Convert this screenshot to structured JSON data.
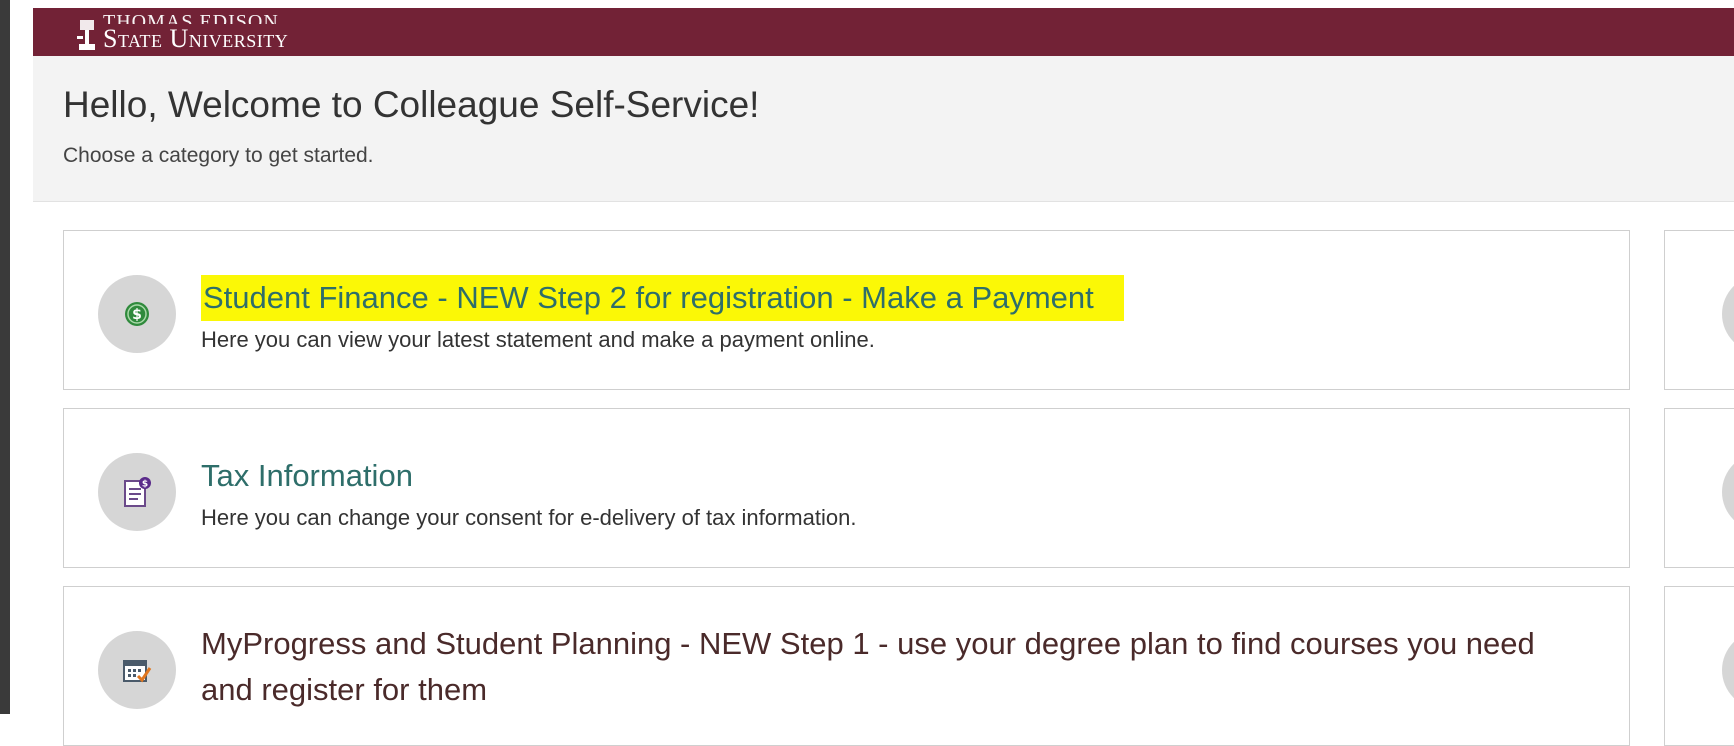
{
  "header": {
    "logo_line1": "THOMAS EDISON",
    "logo_line2": "State University"
  },
  "welcome": {
    "title": "Hello, Welcome to Colleague Self-Service!",
    "subtitle": "Choose a category to get started."
  },
  "categories": [
    {
      "title": "Student Finance - NEW Step 2 for registration - Make a Payment",
      "description": "Here you can view your latest statement and make a payment online.",
      "icon": "dollar-coin-icon",
      "highlighted": true
    },
    {
      "title": "Tax Information",
      "description": "Here you can change your consent for e-delivery of tax information.",
      "icon": "tax-document-icon"
    },
    {
      "title": "MyProgress and Student Planning - NEW Step 1 - use your degree plan to find courses you need and register for them",
      "description": "",
      "icon": "calendar-check-icon"
    }
  ],
  "colors": {
    "header_bg": "#722236",
    "title_teal": "#2e6e6a",
    "highlight": "#fbf806"
  }
}
